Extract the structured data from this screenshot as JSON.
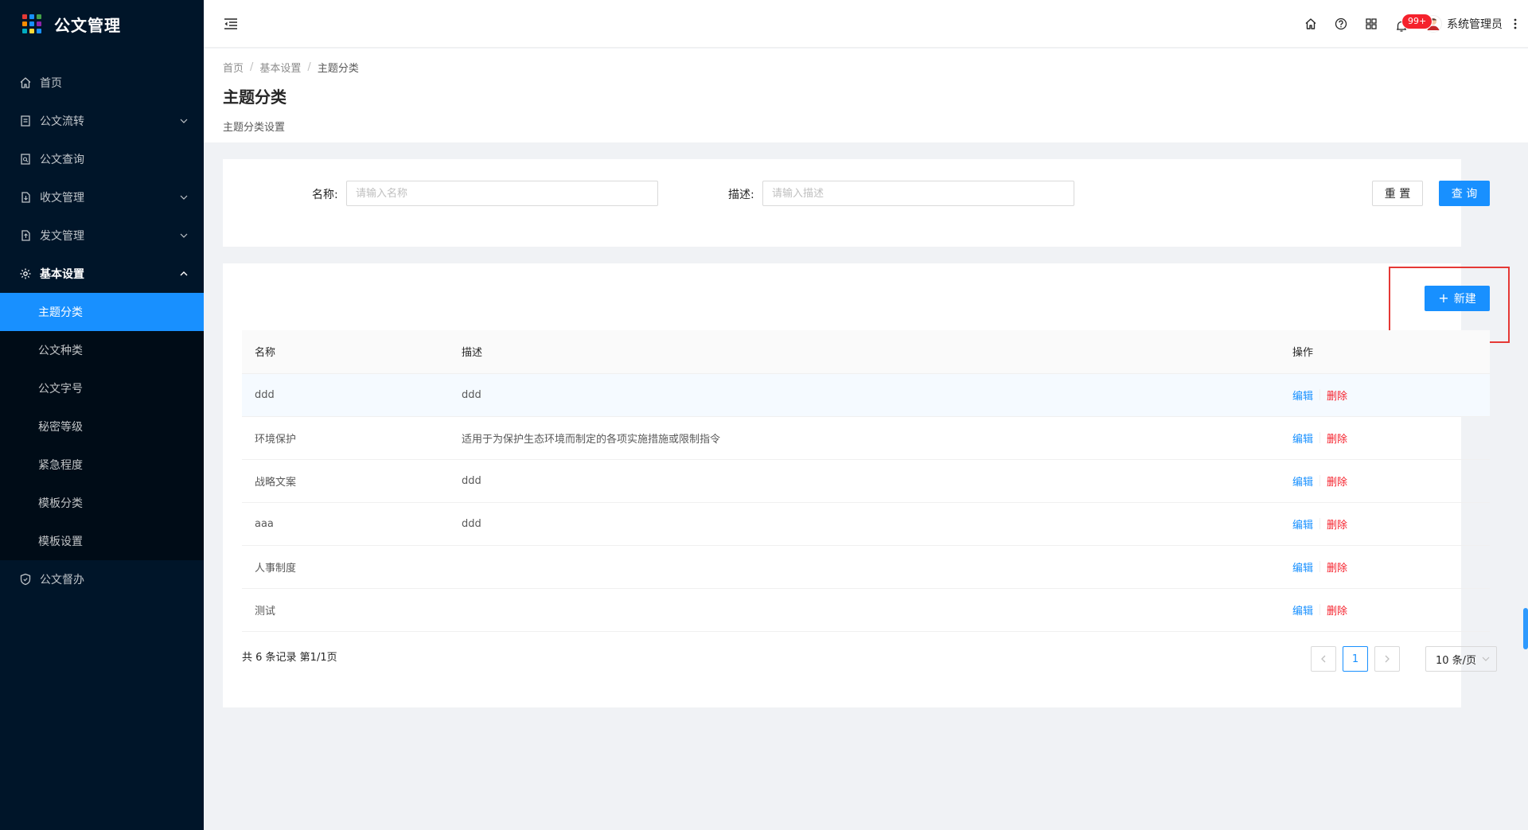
{
  "app": {
    "title": "公文管理",
    "logo_colors": [
      "#e53935",
      "#1890ff",
      "#43a047",
      "#fb8c00",
      "#1890ff",
      "#8e24aa",
      "#00acc1",
      "#fdd835",
      "#1890ff"
    ]
  },
  "sidebar": {
    "items": [
      {
        "label": "首页",
        "icon": "home-icon"
      },
      {
        "label": "公文流转",
        "icon": "doc-icon",
        "expandable": true
      },
      {
        "label": "公文查询",
        "icon": "doc-search-icon"
      },
      {
        "label": "收文管理",
        "icon": "file-in-icon",
        "expandable": true
      },
      {
        "label": "发文管理",
        "icon": "file-out-icon",
        "expandable": true
      },
      {
        "label": "基本设置",
        "icon": "gear-icon",
        "expandable": true,
        "open": true
      },
      {
        "label": "公文督办",
        "icon": "shield-icon"
      }
    ],
    "submenu": [
      {
        "label": "主题分类",
        "active": true
      },
      {
        "label": "公文种类"
      },
      {
        "label": "公文字号"
      },
      {
        "label": "秘密等级"
      },
      {
        "label": "紧急程度"
      },
      {
        "label": "模板分类"
      },
      {
        "label": "模板设置"
      }
    ]
  },
  "header": {
    "notification_count": "99+",
    "user_name": "系统管理员"
  },
  "page": {
    "breadcrumb": [
      "首页",
      "基本设置",
      "主题分类"
    ],
    "title": "主题分类",
    "description": "主题分类设置"
  },
  "search": {
    "name_label": "名称:",
    "name_placeholder": "请输入名称",
    "name_value": "",
    "desc_label": "描述:",
    "desc_placeholder": "请输入描述",
    "desc_value": "",
    "reset_label": "重 置",
    "query_label": "查 询"
  },
  "toolbar": {
    "new_label": "新建"
  },
  "table": {
    "columns": [
      "名称",
      "描述",
      "操作"
    ],
    "rows": [
      {
        "name": "ddd",
        "desc": "ddd"
      },
      {
        "name": "环境保护",
        "desc": "适用于为保护生态环境而制定的各项实施措施或限制指令"
      },
      {
        "name": "战略文案",
        "desc": "ddd"
      },
      {
        "name": "aaa",
        "desc": "ddd"
      },
      {
        "name": "人事制度",
        "desc": ""
      },
      {
        "name": "测试",
        "desc": ""
      }
    ],
    "edit_label": "编辑",
    "delete_label": "删除"
  },
  "pagination": {
    "total_text": "共 6 条记录 第1/1页",
    "current_page": "1",
    "page_size": "10 条/页"
  }
}
